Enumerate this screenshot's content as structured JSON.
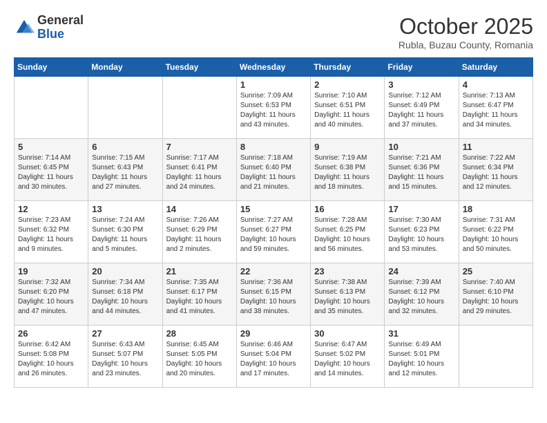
{
  "header": {
    "logo_general": "General",
    "logo_blue": "Blue",
    "month_title": "October 2025",
    "subtitle": "Rubla, Buzau County, Romania"
  },
  "days_of_week": [
    "Sunday",
    "Monday",
    "Tuesday",
    "Wednesday",
    "Thursday",
    "Friday",
    "Saturday"
  ],
  "weeks": [
    [
      {
        "day": "",
        "content": ""
      },
      {
        "day": "",
        "content": ""
      },
      {
        "day": "",
        "content": ""
      },
      {
        "day": "1",
        "content": "Sunrise: 7:09 AM\nSunset: 6:53 PM\nDaylight: 11 hours\nand 43 minutes."
      },
      {
        "day": "2",
        "content": "Sunrise: 7:10 AM\nSunset: 6:51 PM\nDaylight: 11 hours\nand 40 minutes."
      },
      {
        "day": "3",
        "content": "Sunrise: 7:12 AM\nSunset: 6:49 PM\nDaylight: 11 hours\nand 37 minutes."
      },
      {
        "day": "4",
        "content": "Sunrise: 7:13 AM\nSunset: 6:47 PM\nDaylight: 11 hours\nand 34 minutes."
      }
    ],
    [
      {
        "day": "5",
        "content": "Sunrise: 7:14 AM\nSunset: 6:45 PM\nDaylight: 11 hours\nand 30 minutes."
      },
      {
        "day": "6",
        "content": "Sunrise: 7:15 AM\nSunset: 6:43 PM\nDaylight: 11 hours\nand 27 minutes."
      },
      {
        "day": "7",
        "content": "Sunrise: 7:17 AM\nSunset: 6:41 PM\nDaylight: 11 hours\nand 24 minutes."
      },
      {
        "day": "8",
        "content": "Sunrise: 7:18 AM\nSunset: 6:40 PM\nDaylight: 11 hours\nand 21 minutes."
      },
      {
        "day": "9",
        "content": "Sunrise: 7:19 AM\nSunset: 6:38 PM\nDaylight: 11 hours\nand 18 minutes."
      },
      {
        "day": "10",
        "content": "Sunrise: 7:21 AM\nSunset: 6:36 PM\nDaylight: 11 hours\nand 15 minutes."
      },
      {
        "day": "11",
        "content": "Sunrise: 7:22 AM\nSunset: 6:34 PM\nDaylight: 11 hours\nand 12 minutes."
      }
    ],
    [
      {
        "day": "12",
        "content": "Sunrise: 7:23 AM\nSunset: 6:32 PM\nDaylight: 11 hours\nand 9 minutes."
      },
      {
        "day": "13",
        "content": "Sunrise: 7:24 AM\nSunset: 6:30 PM\nDaylight: 11 hours\nand 5 minutes."
      },
      {
        "day": "14",
        "content": "Sunrise: 7:26 AM\nSunset: 6:29 PM\nDaylight: 11 hours\nand 2 minutes."
      },
      {
        "day": "15",
        "content": "Sunrise: 7:27 AM\nSunset: 6:27 PM\nDaylight: 10 hours\nand 59 minutes."
      },
      {
        "day": "16",
        "content": "Sunrise: 7:28 AM\nSunset: 6:25 PM\nDaylight: 10 hours\nand 56 minutes."
      },
      {
        "day": "17",
        "content": "Sunrise: 7:30 AM\nSunset: 6:23 PM\nDaylight: 10 hours\nand 53 minutes."
      },
      {
        "day": "18",
        "content": "Sunrise: 7:31 AM\nSunset: 6:22 PM\nDaylight: 10 hours\nand 50 minutes."
      }
    ],
    [
      {
        "day": "19",
        "content": "Sunrise: 7:32 AM\nSunset: 6:20 PM\nDaylight: 10 hours\nand 47 minutes."
      },
      {
        "day": "20",
        "content": "Sunrise: 7:34 AM\nSunset: 6:18 PM\nDaylight: 10 hours\nand 44 minutes."
      },
      {
        "day": "21",
        "content": "Sunrise: 7:35 AM\nSunset: 6:17 PM\nDaylight: 10 hours\nand 41 minutes."
      },
      {
        "day": "22",
        "content": "Sunrise: 7:36 AM\nSunset: 6:15 PM\nDaylight: 10 hours\nand 38 minutes."
      },
      {
        "day": "23",
        "content": "Sunrise: 7:38 AM\nSunset: 6:13 PM\nDaylight: 10 hours\nand 35 minutes."
      },
      {
        "day": "24",
        "content": "Sunrise: 7:39 AM\nSunset: 6:12 PM\nDaylight: 10 hours\nand 32 minutes."
      },
      {
        "day": "25",
        "content": "Sunrise: 7:40 AM\nSunset: 6:10 PM\nDaylight: 10 hours\nand 29 minutes."
      }
    ],
    [
      {
        "day": "26",
        "content": "Sunrise: 6:42 AM\nSunset: 5:08 PM\nDaylight: 10 hours\nand 26 minutes."
      },
      {
        "day": "27",
        "content": "Sunrise: 6:43 AM\nSunset: 5:07 PM\nDaylight: 10 hours\nand 23 minutes."
      },
      {
        "day": "28",
        "content": "Sunrise: 6:45 AM\nSunset: 5:05 PM\nDaylight: 10 hours\nand 20 minutes."
      },
      {
        "day": "29",
        "content": "Sunrise: 6:46 AM\nSunset: 5:04 PM\nDaylight: 10 hours\nand 17 minutes."
      },
      {
        "day": "30",
        "content": "Sunrise: 6:47 AM\nSunset: 5:02 PM\nDaylight: 10 hours\nand 14 minutes."
      },
      {
        "day": "31",
        "content": "Sunrise: 6:49 AM\nSunset: 5:01 PM\nDaylight: 10 hours\nand 12 minutes."
      },
      {
        "day": "",
        "content": ""
      }
    ]
  ]
}
